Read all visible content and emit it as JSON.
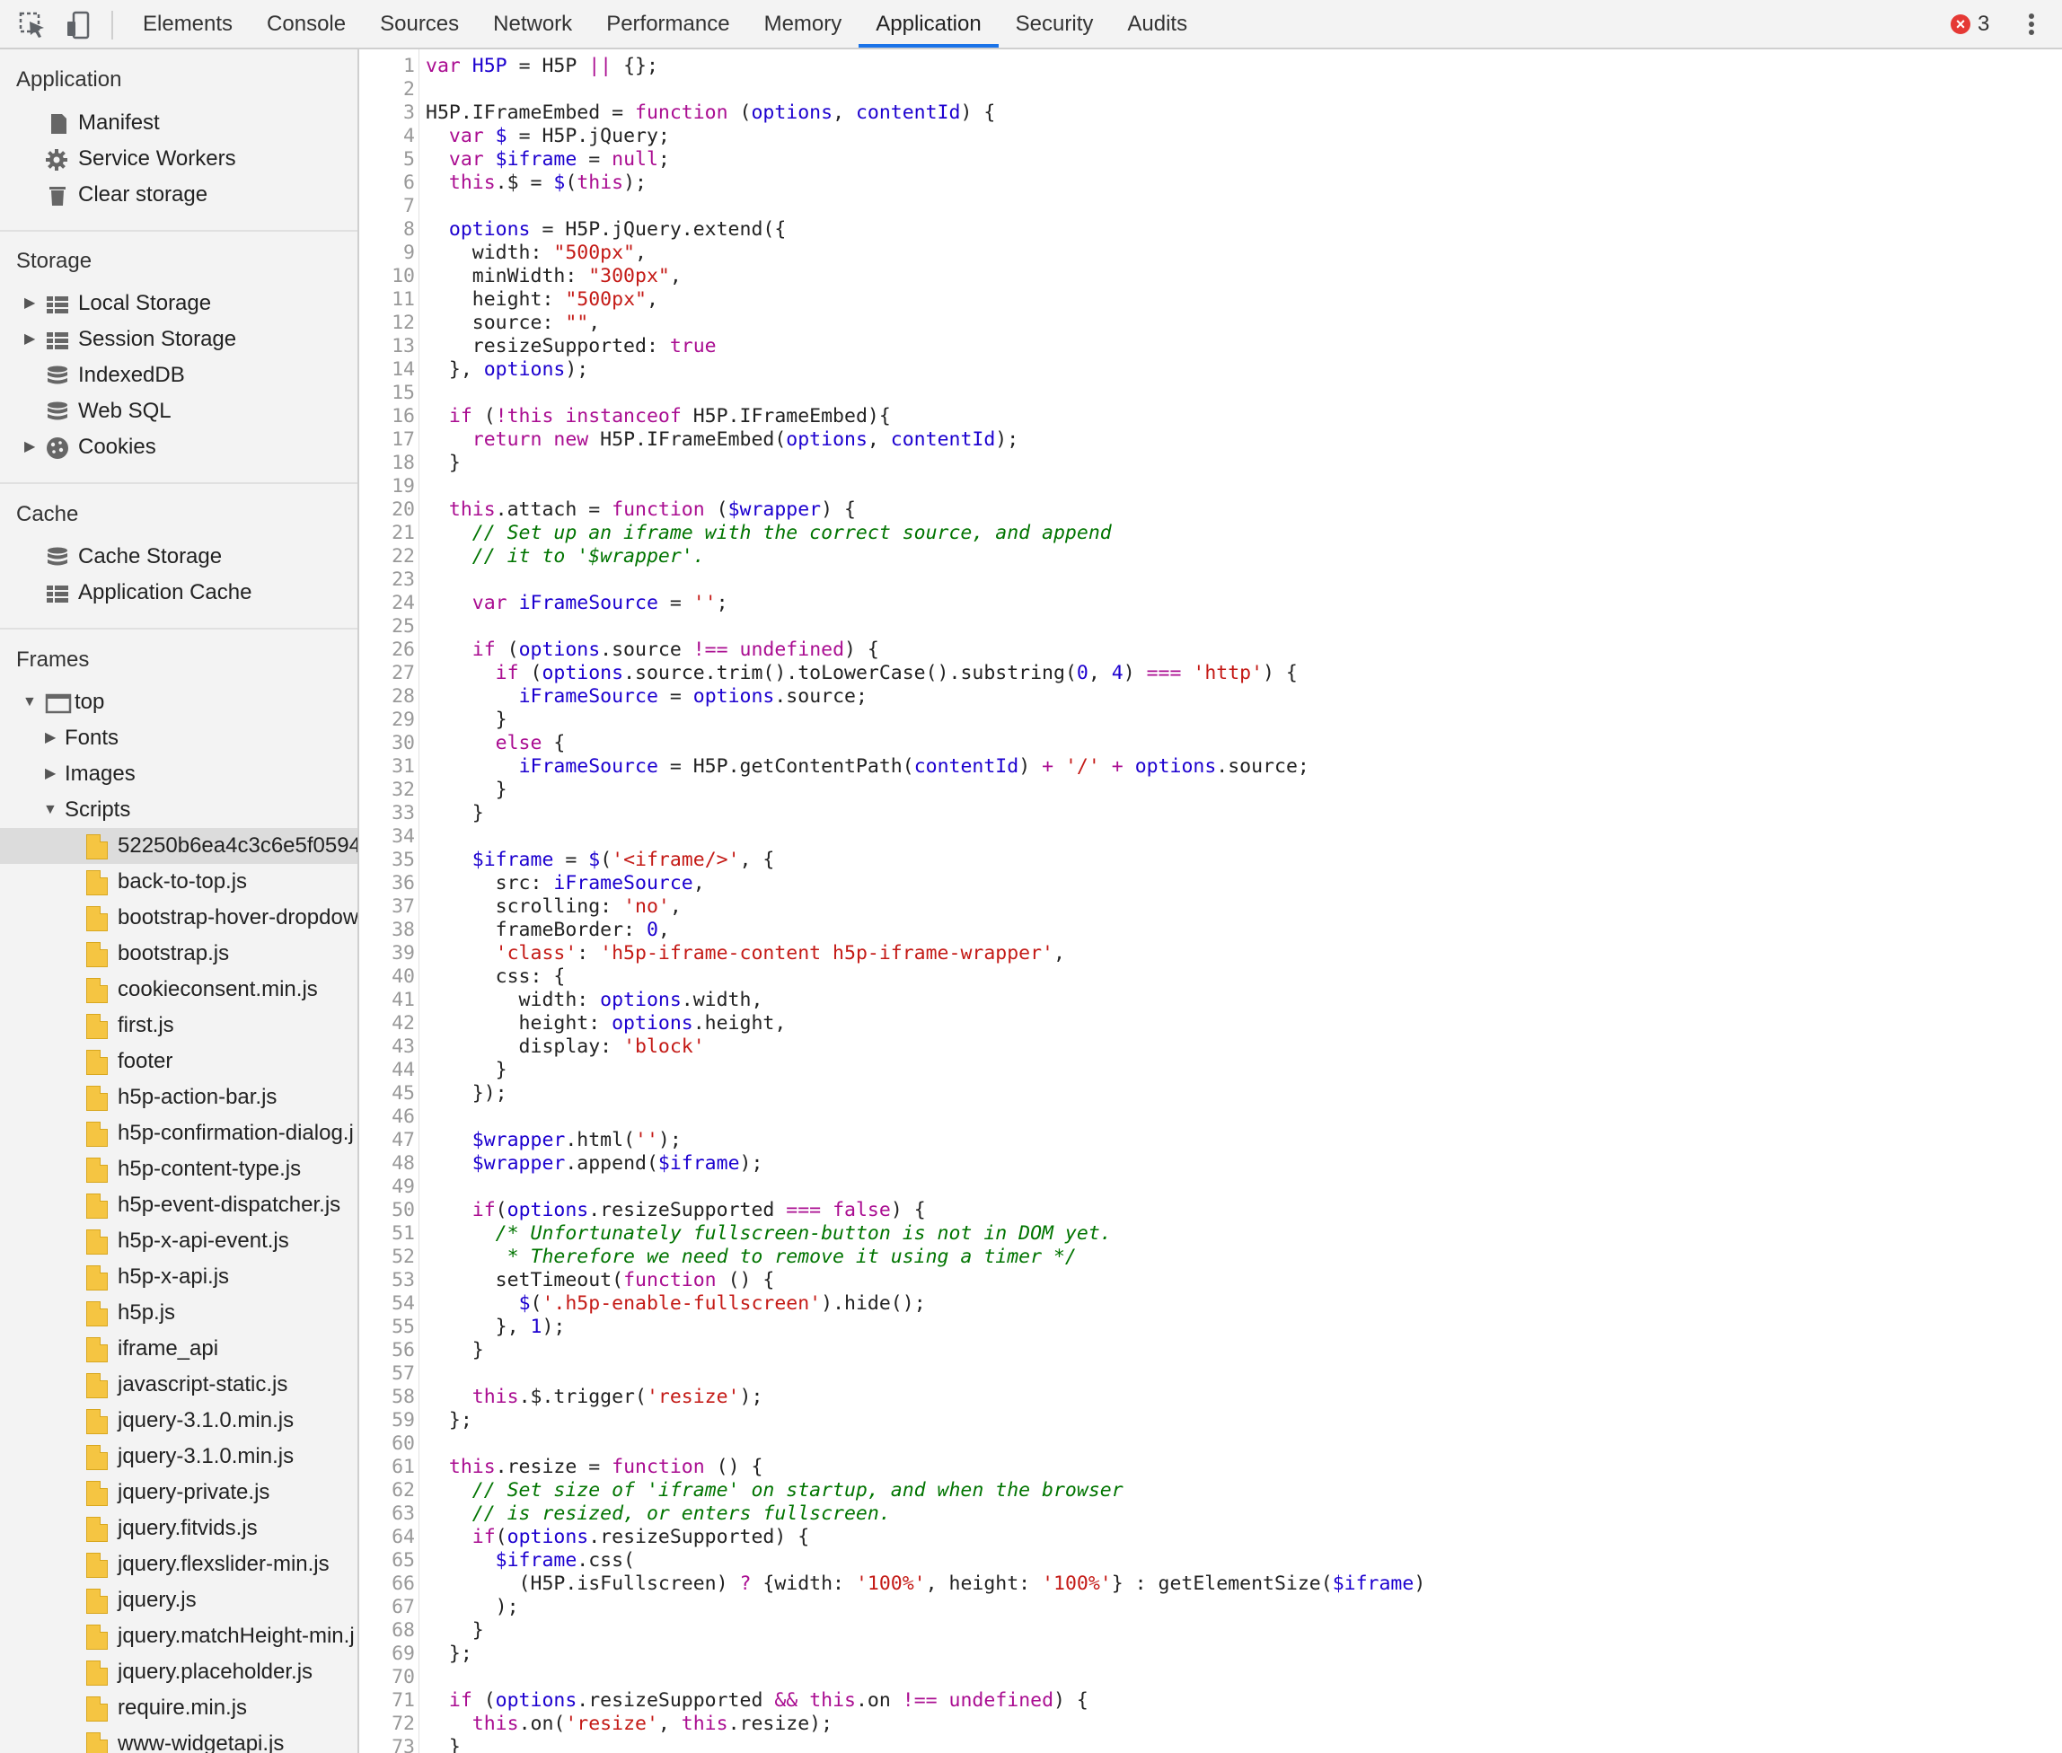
{
  "toolbar": {
    "tabs": [
      "Elements",
      "Console",
      "Sources",
      "Network",
      "Performance",
      "Memory",
      "Application",
      "Security",
      "Audits"
    ],
    "active_tab": "Application",
    "error_count": "3",
    "icons": [
      "inspect-element-icon",
      "device-toolbar-icon",
      "more-options-icon"
    ]
  },
  "sidebar": {
    "application": {
      "title": "Application",
      "items": [
        {
          "label": "Manifest",
          "icon": "document-icon"
        },
        {
          "label": "Service Workers",
          "icon": "gear-icon"
        },
        {
          "label": "Clear storage",
          "icon": "trash-icon"
        }
      ]
    },
    "storage": {
      "title": "Storage",
      "items": [
        {
          "label": "Local Storage",
          "icon": "grid-icon",
          "expandable": true
        },
        {
          "label": "Session Storage",
          "icon": "grid-icon",
          "expandable": true
        },
        {
          "label": "IndexedDB",
          "icon": "database-icon",
          "expandable": false
        },
        {
          "label": "Web SQL",
          "icon": "database-icon",
          "expandable": false
        },
        {
          "label": "Cookies",
          "icon": "cookie-icon",
          "expandable": true
        }
      ]
    },
    "cache": {
      "title": "Cache",
      "items": [
        {
          "label": "Cache Storage",
          "icon": "database-icon"
        },
        {
          "label": "Application Cache",
          "icon": "grid-icon"
        }
      ]
    },
    "frames": {
      "title": "Frames",
      "top": "top",
      "folders": [
        "Fonts",
        "Images",
        "Scripts"
      ],
      "scripts": [
        "52250b6ea4c3c6e5f0594",
        "back-to-top.js",
        "bootstrap-hover-dropdow",
        "bootstrap.js",
        "cookieconsent.min.js",
        "first.js",
        "footer",
        "h5p-action-bar.js",
        "h5p-confirmation-dialog.j",
        "h5p-content-type.js",
        "h5p-event-dispatcher.js",
        "h5p-x-api-event.js",
        "h5p-x-api.js",
        "h5p.js",
        "iframe_api",
        "javascript-static.js",
        "jquery-3.1.0.min.js",
        "jquery-3.1.0.min.js",
        "jquery-private.js",
        "jquery.fitvids.js",
        "jquery.flexslider-min.js",
        "jquery.js",
        "jquery.matchHeight-min.j",
        "jquery.placeholder.js",
        "require.min.js",
        "www-widgetapi.js"
      ],
      "selected_script": "52250b6ea4c3c6e5f0594"
    }
  },
  "colors": {
    "keyword": "#aa0d91",
    "variable": "#1c00cf",
    "string": "#c41a16",
    "comment": "#007400",
    "accent": "#1a73e8"
  },
  "code": {
    "lines": [
      [
        [
          "k",
          "var "
        ],
        [
          "v",
          "H5P"
        ],
        [
          "p",
          " = H5P "
        ],
        [
          "k",
          "||"
        ],
        [
          "p",
          " {};"
        ]
      ],
      [],
      [
        [
          "p",
          "H5P.IFrameEmbed = "
        ],
        [
          "k",
          "function"
        ],
        [
          "p",
          " ("
        ],
        [
          "v",
          "options"
        ],
        [
          "p",
          ", "
        ],
        [
          "v",
          "contentId"
        ],
        [
          "p",
          ") {"
        ]
      ],
      [
        [
          "p",
          "  "
        ],
        [
          "k",
          "var "
        ],
        [
          "v",
          "$"
        ],
        [
          "p",
          " = H5P.jQuery;"
        ]
      ],
      [
        [
          "p",
          "  "
        ],
        [
          "k",
          "var "
        ],
        [
          "v",
          "$iframe"
        ],
        [
          "p",
          " = "
        ],
        [
          "k",
          "null"
        ],
        [
          "p",
          ";"
        ]
      ],
      [
        [
          "p",
          "  "
        ],
        [
          "k",
          "this"
        ],
        [
          "p",
          ".$ = "
        ],
        [
          "v",
          "$"
        ],
        [
          "p",
          "("
        ],
        [
          "k",
          "this"
        ],
        [
          "p",
          ");"
        ]
      ],
      [],
      [
        [
          "p",
          "  "
        ],
        [
          "v",
          "options"
        ],
        [
          "p",
          " = H5P.jQuery.extend({"
        ]
      ],
      [
        [
          "p",
          "    width: "
        ],
        [
          "s",
          "\"500px\""
        ],
        [
          "p",
          ","
        ]
      ],
      [
        [
          "p",
          "    minWidth: "
        ],
        [
          "s",
          "\"300px\""
        ],
        [
          "p",
          ","
        ]
      ],
      [
        [
          "p",
          "    height: "
        ],
        [
          "s",
          "\"500px\""
        ],
        [
          "p",
          ","
        ]
      ],
      [
        [
          "p",
          "    source: "
        ],
        [
          "s",
          "\"\""
        ],
        [
          "p",
          ","
        ]
      ],
      [
        [
          "p",
          "    resizeSupported: "
        ],
        [
          "k",
          "true"
        ]
      ],
      [
        [
          "p",
          "  }, "
        ],
        [
          "v",
          "options"
        ],
        [
          "p",
          ");"
        ]
      ],
      [],
      [
        [
          "p",
          "  "
        ],
        [
          "k",
          "if"
        ],
        [
          "p",
          " ("
        ],
        [
          "k",
          "!this instanceof"
        ],
        [
          "p",
          " H5P.IFrameEmbed){"
        ]
      ],
      [
        [
          "p",
          "    "
        ],
        [
          "k",
          "return new"
        ],
        [
          "p",
          " H5P.IFrameEmbed("
        ],
        [
          "v",
          "options"
        ],
        [
          "p",
          ", "
        ],
        [
          "v",
          "contentId"
        ],
        [
          "p",
          ");"
        ]
      ],
      [
        [
          "p",
          "  }"
        ]
      ],
      [],
      [
        [
          "p",
          "  "
        ],
        [
          "k",
          "this"
        ],
        [
          "p",
          ".attach = "
        ],
        [
          "k",
          "function"
        ],
        [
          "p",
          " ("
        ],
        [
          "v",
          "$wrapper"
        ],
        [
          "p",
          ") {"
        ]
      ],
      [
        [
          "p",
          "    "
        ],
        [
          "c",
          "// Set up an iframe with the correct source, and append"
        ]
      ],
      [
        [
          "p",
          "    "
        ],
        [
          "c",
          "// it to '$wrapper'."
        ]
      ],
      [],
      [
        [
          "p",
          "    "
        ],
        [
          "k",
          "var "
        ],
        [
          "v",
          "iFrameSource"
        ],
        [
          "p",
          " = "
        ],
        [
          "s",
          "''"
        ],
        [
          "p",
          ";"
        ]
      ],
      [],
      [
        [
          "p",
          "    "
        ],
        [
          "k",
          "if"
        ],
        [
          "p",
          " ("
        ],
        [
          "v",
          "options"
        ],
        [
          "p",
          ".source "
        ],
        [
          "k",
          "!=="
        ],
        [
          "p",
          " "
        ],
        [
          "k",
          "undefined"
        ],
        [
          "p",
          ") {"
        ]
      ],
      [
        [
          "p",
          "      "
        ],
        [
          "k",
          "if"
        ],
        [
          "p",
          " ("
        ],
        [
          "v",
          "options"
        ],
        [
          "p",
          ".source.trim().toLowerCase().substring("
        ],
        [
          "v",
          "0"
        ],
        [
          "p",
          ", "
        ],
        [
          "v",
          "4"
        ],
        [
          "p",
          ") "
        ],
        [
          "k",
          "==="
        ],
        [
          "p",
          " "
        ],
        [
          "s",
          "'http'"
        ],
        [
          "p",
          ") {"
        ]
      ],
      [
        [
          "p",
          "        "
        ],
        [
          "v",
          "iFrameSource"
        ],
        [
          "p",
          " = "
        ],
        [
          "v",
          "options"
        ],
        [
          "p",
          ".source;"
        ]
      ],
      [
        [
          "p",
          "      }"
        ]
      ],
      [
        [
          "p",
          "      "
        ],
        [
          "k",
          "else"
        ],
        [
          "p",
          " {"
        ]
      ],
      [
        [
          "p",
          "        "
        ],
        [
          "v",
          "iFrameSource"
        ],
        [
          "p",
          " = H5P.getContentPath("
        ],
        [
          "v",
          "contentId"
        ],
        [
          "p",
          ") "
        ],
        [
          "k",
          "+"
        ],
        [
          "p",
          " "
        ],
        [
          "s",
          "'/'"
        ],
        [
          "p",
          " "
        ],
        [
          "k",
          "+"
        ],
        [
          "p",
          " "
        ],
        [
          "v",
          "options"
        ],
        [
          "p",
          ".source;"
        ]
      ],
      [
        [
          "p",
          "      }"
        ]
      ],
      [
        [
          "p",
          "    }"
        ]
      ],
      [],
      [
        [
          "p",
          "    "
        ],
        [
          "v",
          "$iframe"
        ],
        [
          "p",
          " = "
        ],
        [
          "v",
          "$"
        ],
        [
          "p",
          "("
        ],
        [
          "s",
          "'<iframe/>'"
        ],
        [
          "p",
          ", {"
        ]
      ],
      [
        [
          "p",
          "      src: "
        ],
        [
          "v",
          "iFrameSource"
        ],
        [
          "p",
          ","
        ]
      ],
      [
        [
          "p",
          "      scrolling: "
        ],
        [
          "s",
          "'no'"
        ],
        [
          "p",
          ","
        ]
      ],
      [
        [
          "p",
          "      frameBorder: "
        ],
        [
          "v",
          "0"
        ],
        [
          "p",
          ","
        ]
      ],
      [
        [
          "p",
          "      "
        ],
        [
          "s",
          "'class'"
        ],
        [
          "p",
          ": "
        ],
        [
          "s",
          "'h5p-iframe-content h5p-iframe-wrapper'"
        ],
        [
          "p",
          ","
        ]
      ],
      [
        [
          "p",
          "      css: {"
        ]
      ],
      [
        [
          "p",
          "        width: "
        ],
        [
          "v",
          "options"
        ],
        [
          "p",
          ".width,"
        ]
      ],
      [
        [
          "p",
          "        height: "
        ],
        [
          "v",
          "options"
        ],
        [
          "p",
          ".height,"
        ]
      ],
      [
        [
          "p",
          "        display: "
        ],
        [
          "s",
          "'block'"
        ]
      ],
      [
        [
          "p",
          "      }"
        ]
      ],
      [
        [
          "p",
          "    });"
        ]
      ],
      [],
      [
        [
          "p",
          "    "
        ],
        [
          "v",
          "$wrapper"
        ],
        [
          "p",
          ".html("
        ],
        [
          "s",
          "''"
        ],
        [
          "p",
          ");"
        ]
      ],
      [
        [
          "p",
          "    "
        ],
        [
          "v",
          "$wrapper"
        ],
        [
          "p",
          ".append("
        ],
        [
          "v",
          "$iframe"
        ],
        [
          "p",
          ");"
        ]
      ],
      [],
      [
        [
          "p",
          "    "
        ],
        [
          "k",
          "if"
        ],
        [
          "p",
          "("
        ],
        [
          "v",
          "options"
        ],
        [
          "p",
          ".resizeSupported "
        ],
        [
          "k",
          "==="
        ],
        [
          "p",
          " "
        ],
        [
          "k",
          "false"
        ],
        [
          "p",
          ") {"
        ]
      ],
      [
        [
          "p",
          "      "
        ],
        [
          "c",
          "/* Unfortunately fullscreen-button is not in DOM yet."
        ]
      ],
      [
        [
          "p",
          "       "
        ],
        [
          "c",
          "* Therefore we need to remove it using a timer */"
        ]
      ],
      [
        [
          "p",
          "      setTimeout("
        ],
        [
          "k",
          "function"
        ],
        [
          "p",
          " () {"
        ]
      ],
      [
        [
          "p",
          "        "
        ],
        [
          "v",
          "$"
        ],
        [
          "p",
          "("
        ],
        [
          "s",
          "'.h5p-enable-fullscreen'"
        ],
        [
          "p",
          ").hide();"
        ]
      ],
      [
        [
          "p",
          "      }, "
        ],
        [
          "v",
          "1"
        ],
        [
          "p",
          ");"
        ]
      ],
      [
        [
          "p",
          "    }"
        ]
      ],
      [],
      [
        [
          "p",
          "    "
        ],
        [
          "k",
          "this"
        ],
        [
          "p",
          ".$.trigger("
        ],
        [
          "s",
          "'resize'"
        ],
        [
          "p",
          ");"
        ]
      ],
      [
        [
          "p",
          "  };"
        ]
      ],
      [],
      [
        [
          "p",
          "  "
        ],
        [
          "k",
          "this"
        ],
        [
          "p",
          ".resize = "
        ],
        [
          "k",
          "function"
        ],
        [
          "p",
          " () {"
        ]
      ],
      [
        [
          "p",
          "    "
        ],
        [
          "c",
          "// Set size of 'iframe' on startup, and when the browser"
        ]
      ],
      [
        [
          "p",
          "    "
        ],
        [
          "c",
          "// is resized, or enters fullscreen."
        ]
      ],
      [
        [
          "p",
          "    "
        ],
        [
          "k",
          "if"
        ],
        [
          "p",
          "("
        ],
        [
          "v",
          "options"
        ],
        [
          "p",
          ".resizeSupported) {"
        ]
      ],
      [
        [
          "p",
          "      "
        ],
        [
          "v",
          "$iframe"
        ],
        [
          "p",
          ".css("
        ]
      ],
      [
        [
          "p",
          "        (H5P.isFullscreen) "
        ],
        [
          "k",
          "?"
        ],
        [
          "p",
          " {width: "
        ],
        [
          "s",
          "'100%'"
        ],
        [
          "p",
          ", height: "
        ],
        [
          "s",
          "'100%'"
        ],
        [
          "p",
          "} : getElementSize("
        ],
        [
          "v",
          "$iframe"
        ],
        [
          "p",
          ")"
        ]
      ],
      [
        [
          "p",
          "      );"
        ]
      ],
      [
        [
          "p",
          "    }"
        ]
      ],
      [
        [
          "p",
          "  };"
        ]
      ],
      [],
      [
        [
          "p",
          "  "
        ],
        [
          "k",
          "if"
        ],
        [
          "p",
          " ("
        ],
        [
          "v",
          "options"
        ],
        [
          "p",
          ".resizeSupported "
        ],
        [
          "k",
          "&&"
        ],
        [
          "p",
          " "
        ],
        [
          "k",
          "this"
        ],
        [
          "p",
          ".on "
        ],
        [
          "k",
          "!=="
        ],
        [
          "p",
          " "
        ],
        [
          "k",
          "undefined"
        ],
        [
          "p",
          ") {"
        ]
      ],
      [
        [
          "p",
          "    "
        ],
        [
          "k",
          "this"
        ],
        [
          "p",
          ".on("
        ],
        [
          "s",
          "'resize'"
        ],
        [
          "p",
          ", "
        ],
        [
          "k",
          "this"
        ],
        [
          "p",
          ".resize);"
        ]
      ],
      [
        [
          "p",
          "  }"
        ]
      ]
    ]
  }
}
